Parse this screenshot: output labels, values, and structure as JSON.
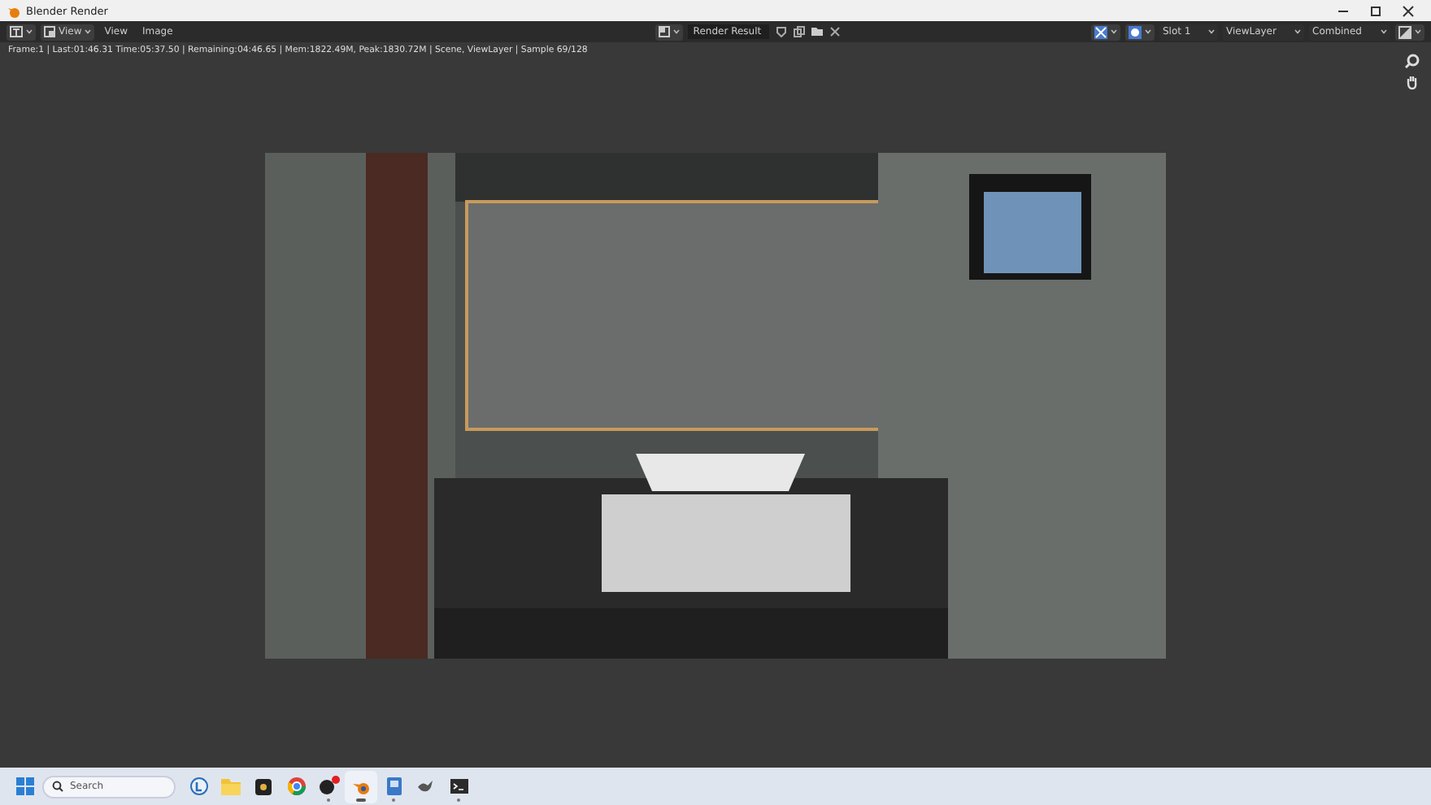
{
  "window": {
    "title": "Blender Render"
  },
  "header": {
    "view_dropdown": "View",
    "menus": [
      "View",
      "Image"
    ],
    "image_name": "Render Result",
    "slot": "Slot 1",
    "view_layer": "ViewLayer",
    "pass": "Combined"
  },
  "status_text": "Frame:1 | Last:01:46.31 Time:05:37.50 | Remaining:04:46.65 | Mem:1822.49M, Peak:1830.72M | Scene, ViewLayer | Sample 69/128",
  "taskbar": {
    "search": {
      "placeholder": "Search"
    },
    "apps": [
      {
        "kind": "widget",
        "running": false,
        "active": false,
        "badge": false
      },
      {
        "kind": "folder",
        "running": false,
        "active": false,
        "badge": false
      },
      {
        "kind": "editor",
        "running": false,
        "active": false,
        "badge": false
      },
      {
        "kind": "browser",
        "running": false,
        "active": false,
        "badge": false
      },
      {
        "kind": "media",
        "running": true,
        "active": false,
        "badge": true
      },
      {
        "kind": "blender",
        "running": true,
        "active": true,
        "badge": false
      },
      {
        "kind": "document",
        "running": true,
        "active": false,
        "badge": false
      },
      {
        "kind": "bird",
        "running": false,
        "active": false,
        "badge": false
      },
      {
        "kind": "terminal",
        "running": true,
        "active": false,
        "badge": false
      }
    ]
  }
}
